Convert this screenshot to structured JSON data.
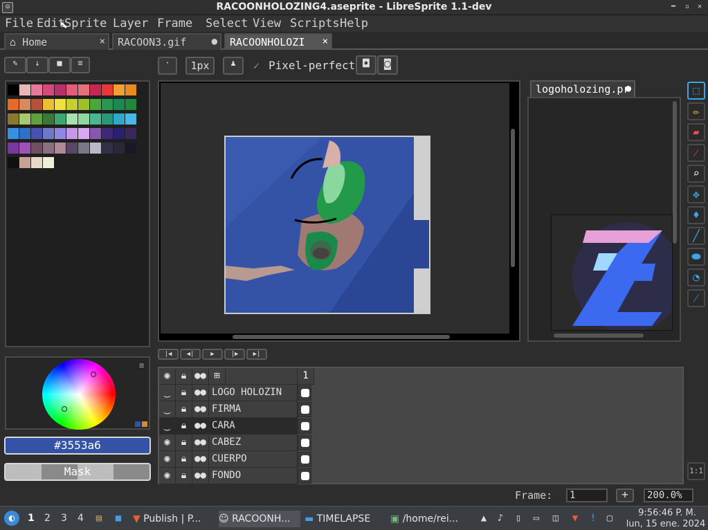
{
  "window": {
    "title": "RACOONHOLOZING4.aseprite - LibreSprite 1.1-dev"
  },
  "menu": [
    "File",
    "Edit",
    "Sprite",
    "Layer",
    "Frame",
    "Select",
    "View",
    "Scripts",
    "Help"
  ],
  "tabs": [
    {
      "label": "Home",
      "active": false,
      "marker": "×"
    },
    {
      "label": "RACOON3.gif",
      "active": false,
      "marker": "●"
    },
    {
      "label": "RACOONHOLOZI",
      "active": true,
      "marker": "×"
    }
  ],
  "toolbar": {
    "brush_size": "1px",
    "pixel_perfect_label": "Pixel-perfect",
    "pixel_perfect_checked": true
  },
  "palette": {
    "colors": [
      "#000000",
      "#e8b8b8",
      "#e67a9a",
      "#d44a7a",
      "#b8306a",
      "#e85a7a",
      "#e8707a",
      "#c82850",
      "#e83838",
      "#f0a030",
      "#e88a20",
      "#e86a2a",
      "#d88a5a",
      "#b8503a",
      "#e8c030",
      "#f0e040",
      "#c8d030",
      "#a0c028",
      "#4aa838",
      "#289850",
      "#1a8a50",
      "#208a3a",
      "#8a7a30",
      "#a8c870",
      "#60a040",
      "#3a7838",
      "#3aa870",
      "#a8e0b0",
      "#90d8a0",
      "#48b890",
      "#289878",
      "#30a8c8",
      "#48b8e8",
      "#3890e0",
      "#3070c8",
      "#4850b0",
      "#7078c8",
      "#9088e0",
      "#c898e8",
      "#d8a8f0",
      "#8858b0",
      "#402878",
      "#282070",
      "#3a2858",
      "#7838a0",
      "#a050b8",
      "#705060",
      "#8a7080",
      "#b08898",
      "#584868",
      "#787888",
      "#b8b8c8",
      "#303048",
      "#282838",
      "#181828",
      "#101010",
      "#c8a098",
      "#e8d8c8",
      "#f0f0d8"
    ],
    "current_hex": "#3553a6",
    "mask_label": "Mask"
  },
  "preview": {
    "tab_label": "logoholozing.pr"
  },
  "timeline": {
    "frame_number": "1",
    "layers": [
      {
        "name": "LOGO HOLOZIN",
        "visible": false
      },
      {
        "name": "FIRMA",
        "visible": false
      },
      {
        "name": "CARA",
        "visible": false,
        "selected": true
      },
      {
        "name": "CABEZ",
        "visible": true
      },
      {
        "name": "CUERPO",
        "visible": true
      },
      {
        "name": "FONDO",
        "visible": true
      }
    ]
  },
  "status": {
    "frame_label": "Frame:",
    "frame_value": "1",
    "zoom": "200.0%"
  },
  "taskbar": {
    "workspaces": [
      "1",
      "2",
      "3",
      "4"
    ],
    "apps": [
      {
        "label": "Publish | P..."
      },
      {
        "label": "RACOONH..."
      },
      {
        "label": "TIMELAPSE"
      },
      {
        "label": "/home/rei..."
      }
    ],
    "clock_time": "9:56:46 P. M.",
    "clock_date": "lun, 15 ene. 2024"
  },
  "colors": {
    "canvas_bg": "#3553a6",
    "accent": "#3ba6e5"
  },
  "icons": [
    "app-icon",
    "home-icon",
    "pencil-icon",
    "eraser-icon",
    "eyedropper-icon",
    "zoom-icon",
    "move-icon",
    "bucket-icon",
    "line-icon",
    "ellipse-icon",
    "curve-icon",
    "blur-icon",
    "marquee-icon",
    "eye-icon",
    "lock-icon"
  ]
}
